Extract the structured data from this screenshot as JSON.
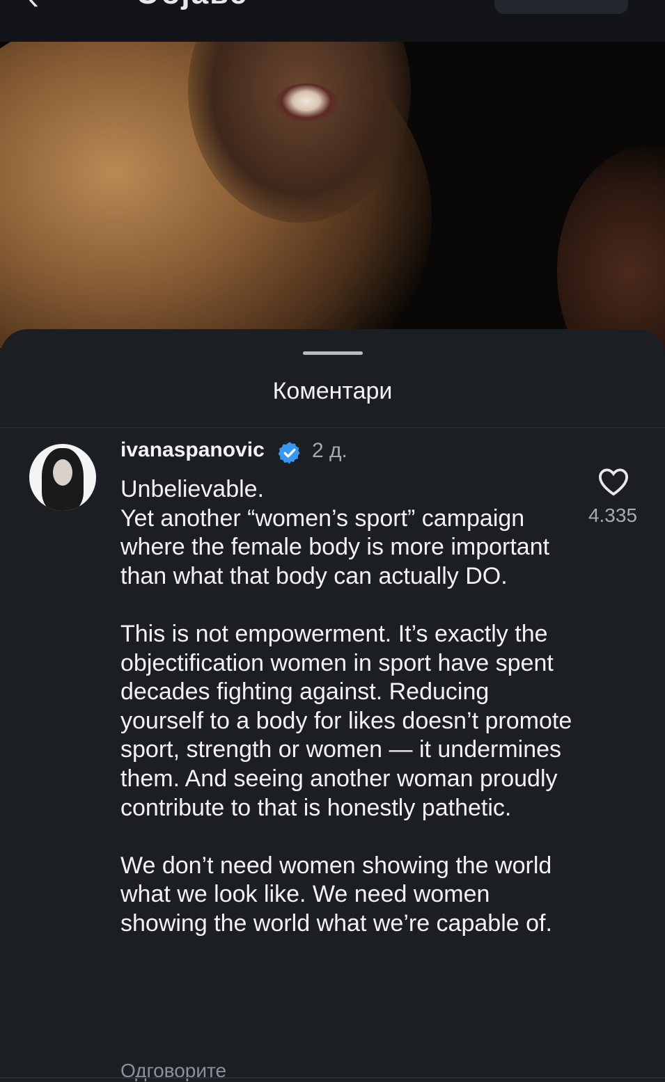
{
  "header": {
    "title": "Објаве",
    "back_icon": "chevron-left-icon"
  },
  "sheet": {
    "title": "Коментари"
  },
  "comment": {
    "username": "ivanaspanovic",
    "verified_icon": "verified-badge-icon",
    "time": "2 д.",
    "text": "Unbelievable.\nYet another “women’s sport” campaign where the female body is more important than what that body can actually DO.\n\nThis is not empowerment. It’s exactly the objectification women in sport have spent decades fighting against. Reducing yourself to a body for likes doesn’t promote sport, strength or women — it undermines them. And seeing another woman proudly contribute to that is honestly pathetic.\n\nWe don’t need women showing the world what we look like. We need women showing the world what we’re capable of.",
    "likes": "4.335",
    "reply_label": "Одговорите"
  },
  "colors": {
    "sheet_bg": "#1b1e23",
    "verified": "#3897f0",
    "muted_text": "#a8abb1"
  }
}
